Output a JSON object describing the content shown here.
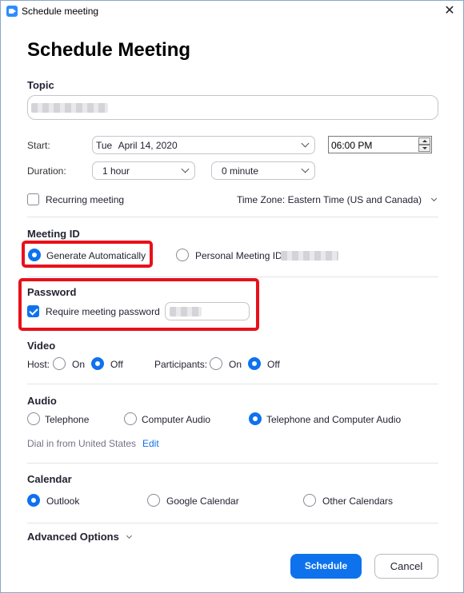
{
  "window": {
    "title": "Schedule meeting"
  },
  "heading": "Schedule Meeting",
  "topic": {
    "label": "Topic"
  },
  "start": {
    "label": "Start:",
    "date_day": "Tue",
    "date": "April 14, 2020",
    "time": "06:00 PM"
  },
  "duration": {
    "label": "Duration:",
    "hours": "1 hour",
    "minutes": "0 minute"
  },
  "recurring": {
    "label": "Recurring meeting",
    "checked": false
  },
  "timezone": {
    "label": "Time Zone: Eastern Time (US and Canada)"
  },
  "meeting_id": {
    "label": "Meeting ID",
    "options": [
      "Generate Automatically",
      "Personal Meeting ID"
    ],
    "selected": "Generate Automatically"
  },
  "password": {
    "label": "Password",
    "require_label": "Require meeting password",
    "checked": true
  },
  "video": {
    "label": "Video",
    "host_label": "Host:",
    "participants_label": "Participants:",
    "on_label": "On",
    "off_label": "Off",
    "host": "Off",
    "participants": "Off"
  },
  "audio": {
    "label": "Audio",
    "options": [
      "Telephone",
      "Computer Audio",
      "Telephone and Computer Audio"
    ],
    "selected": "Telephone and Computer Audio",
    "dial_in": "Dial in from United States",
    "edit_label": "Edit"
  },
  "calendar": {
    "label": "Calendar",
    "options": [
      "Outlook",
      "Google Calendar",
      "Other Calendars"
    ],
    "selected": "Outlook"
  },
  "advanced": {
    "label": "Advanced Options"
  },
  "buttons": {
    "schedule": "Schedule",
    "cancel": "Cancel"
  },
  "colors": {
    "accent": "#0e72ed",
    "highlight": "#e8101a"
  },
  "icons": [
    "zoom-app-icon",
    "close-icon",
    "chevron-down-icon",
    "check-icon"
  ]
}
